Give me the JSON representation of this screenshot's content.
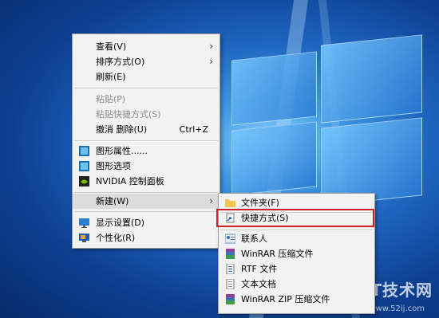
{
  "context_menu": {
    "items": [
      {
        "label": "查看(V)",
        "has_submenu": true
      },
      {
        "label": "排序方式(O)",
        "has_submenu": true
      },
      {
        "label": "刷新(E)"
      },
      {
        "label": "粘贴(P)",
        "disabled": true
      },
      {
        "label": "粘贴快捷方式(S)",
        "disabled": true
      },
      {
        "label": "撤消 删除(U)",
        "shortcut": "Ctrl+Z"
      },
      {
        "label": "图形属性......"
      },
      {
        "label": "图形选项"
      },
      {
        "label": "NVIDIA 控制面板"
      },
      {
        "label": "新建(W)",
        "has_submenu": true,
        "active": true
      },
      {
        "label": "显示设置(D)"
      },
      {
        "label": "个性化(R)"
      }
    ]
  },
  "new_submenu": {
    "items": [
      {
        "label": "文件夹(F)",
        "icon": "folder-icon"
      },
      {
        "label": "快捷方式(S)",
        "icon": "shortcut-icon",
        "highlighted": true
      },
      {
        "label": "联系人",
        "icon": "contact-icon"
      },
      {
        "label": "WinRAR 压缩文件",
        "icon": "winrar-icon"
      },
      {
        "label": "RTF 文件",
        "icon": "rtf-icon"
      },
      {
        "label": "文本文档",
        "icon": "text-document-icon"
      },
      {
        "label": "WinRAR ZIP 压缩文件",
        "icon": "winrar-zip-icon"
      }
    ]
  },
  "watermark": {
    "text": "我爱IT技术网",
    "sub": "www.52ij.com"
  },
  "colors": {
    "highlight_border": "#cc2222",
    "menu_bg": "#f2f2f2"
  }
}
